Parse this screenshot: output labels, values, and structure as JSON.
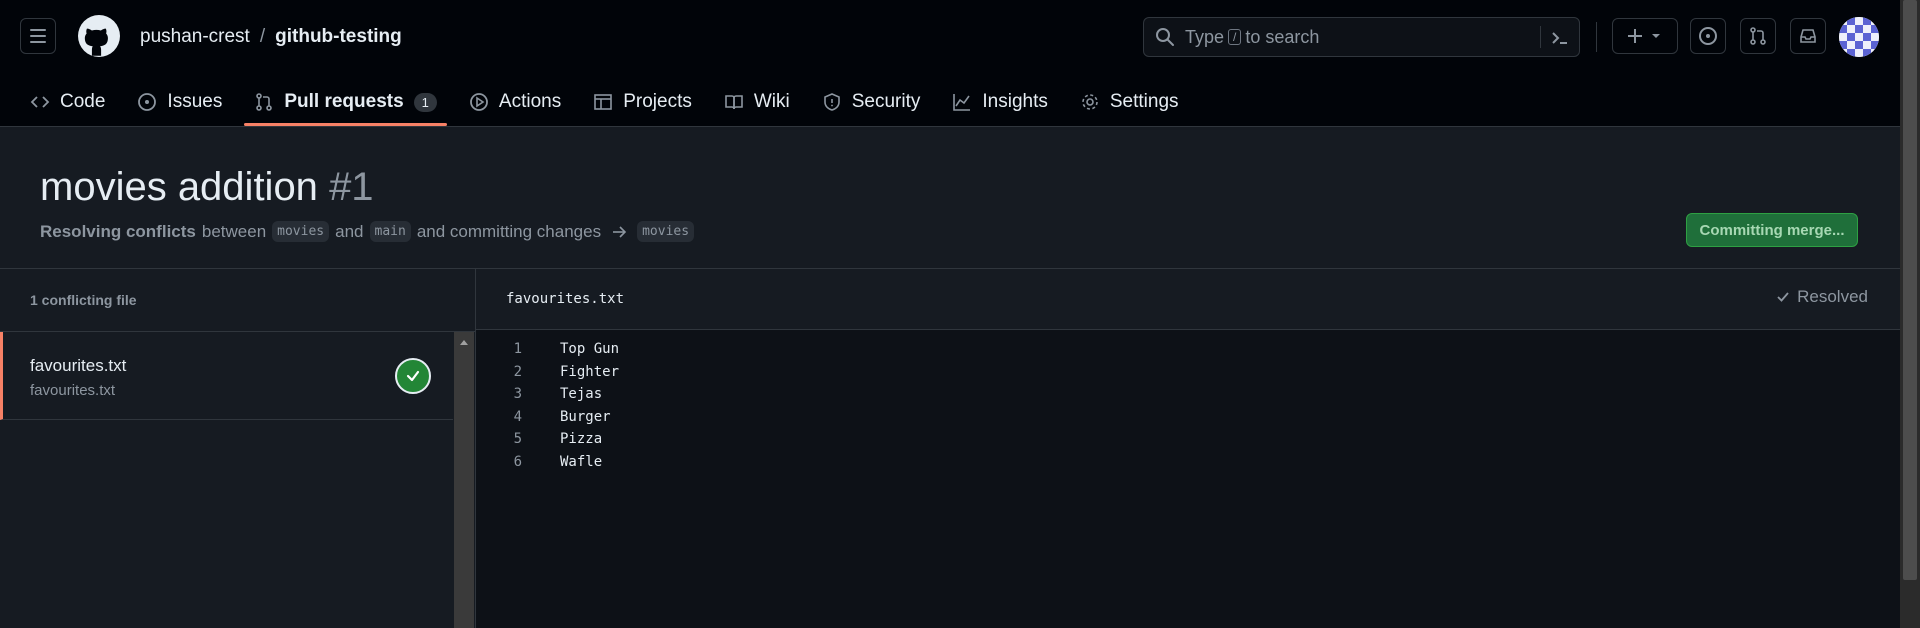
{
  "header": {
    "owner": "pushan-crest",
    "separator": "/",
    "repo": "github-testing",
    "search": {
      "placeholder_before": "Type",
      "shortcut_key": "/",
      "placeholder_after": "to search"
    }
  },
  "tabs": [
    {
      "label": "Code"
    },
    {
      "label": "Issues"
    },
    {
      "label": "Pull requests",
      "count": "1"
    },
    {
      "label": "Actions"
    },
    {
      "label": "Projects"
    },
    {
      "label": "Wiki"
    },
    {
      "label": "Security"
    },
    {
      "label": "Insights"
    },
    {
      "label": "Settings"
    }
  ],
  "pr": {
    "title": "movies addition",
    "number": "#1",
    "status_bold": "Resolving conflicts",
    "between": "between",
    "head_branch": "movies",
    "and": "and",
    "base_branch": "main",
    "committing": "and committing changes",
    "target_branch": "movies",
    "merge_button": "Committing merge..."
  },
  "conflicts": {
    "header": "1 conflicting file",
    "files": [
      {
        "name": "favourites.txt",
        "path": "favourites.txt"
      }
    ]
  },
  "editor": {
    "filename": "favourites.txt",
    "status": "Resolved",
    "lines": [
      {
        "n": "1",
        "text": "Top Gun"
      },
      {
        "n": "2",
        "text": "Fighter"
      },
      {
        "n": "3",
        "text": "Tejas"
      },
      {
        "n": "4",
        "text": "Burger"
      },
      {
        "n": "5",
        "text": "Pizza"
      },
      {
        "n": "6",
        "text": "Wafle"
      }
    ]
  },
  "colors": {
    "accent": "#f78166",
    "success": "#238636",
    "bg": "#0d1117",
    "panel": "#161b22"
  }
}
